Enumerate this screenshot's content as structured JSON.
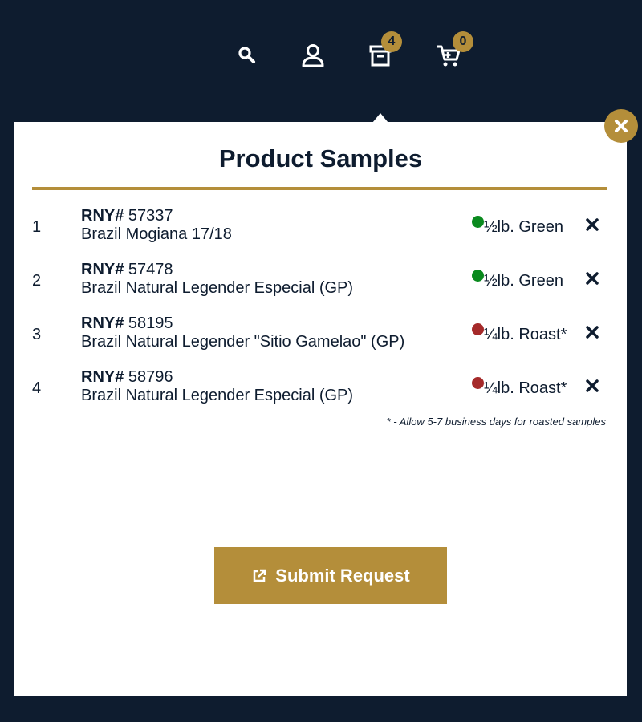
{
  "header": {
    "icons": [
      "search-icon",
      "user-icon",
      "sample-box-icon",
      "cart-icon"
    ],
    "samples_count": "4",
    "cart_count": "0"
  },
  "panel": {
    "title": "Product Samples",
    "close_icon": "close-icon",
    "rny_label": "RNY#",
    "items": [
      {
        "num": "1",
        "rny": "57337",
        "name": "Brazil Mogiana 17/18",
        "option": "½lb. Green",
        "status_color": "#0a8a1e"
      },
      {
        "num": "2",
        "rny": "57478",
        "name": "Brazil Natural Legender Especial (GP)",
        "option": "½lb. Green",
        "status_color": "#0a8a1e"
      },
      {
        "num": "3",
        "rny": "58195",
        "name": "Brazil Natural Legender \"Sitio Gamelao\" (GP)",
        "option": "¼lb. Roast*",
        "status_color": "#a52a2a"
      },
      {
        "num": "4",
        "rny": "58796",
        "name": "Brazil Natural Legender Especial (GP)",
        "option": "¼lb. Roast*",
        "status_color": "#a52a2a"
      }
    ],
    "footnote": "* - Allow 5-7 business days for roasted samples",
    "submit_label": "Submit Request"
  },
  "colors": {
    "background": "#0e1c2f",
    "accent": "#b48e3a",
    "panel": "#ffffff"
  }
}
